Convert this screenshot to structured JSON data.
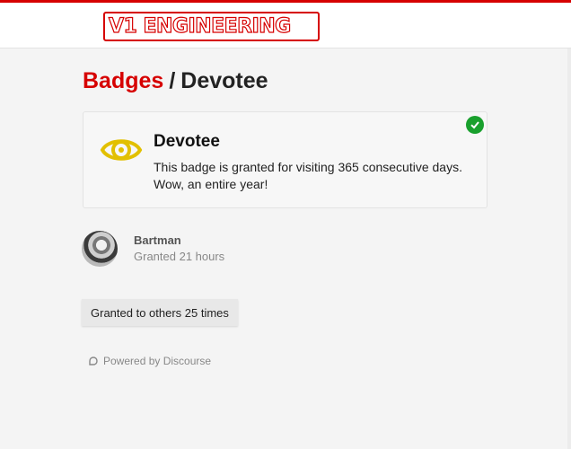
{
  "header": {
    "logo_text": "V1 ENGINEERING",
    "brand_color": "#d60000"
  },
  "breadcrumb": {
    "parent_label": "Badges",
    "separator": "/",
    "current_label": "Devotee"
  },
  "badge": {
    "icon": "eye-icon",
    "icon_color": "#e2c000",
    "title": "Devotee",
    "description": "This badge is granted for visiting 365 consecutive days. Wow, an entire year!",
    "granted_icon": "check-circle-icon",
    "granted_color": "#19a02d"
  },
  "grant": {
    "username": "Bartman",
    "granted_text": "Granted 21 hours"
  },
  "others_button": {
    "label": "Granted to others 25 times"
  },
  "footer": {
    "icon": "discourse-icon",
    "powered_by": "Powered by Discourse"
  }
}
